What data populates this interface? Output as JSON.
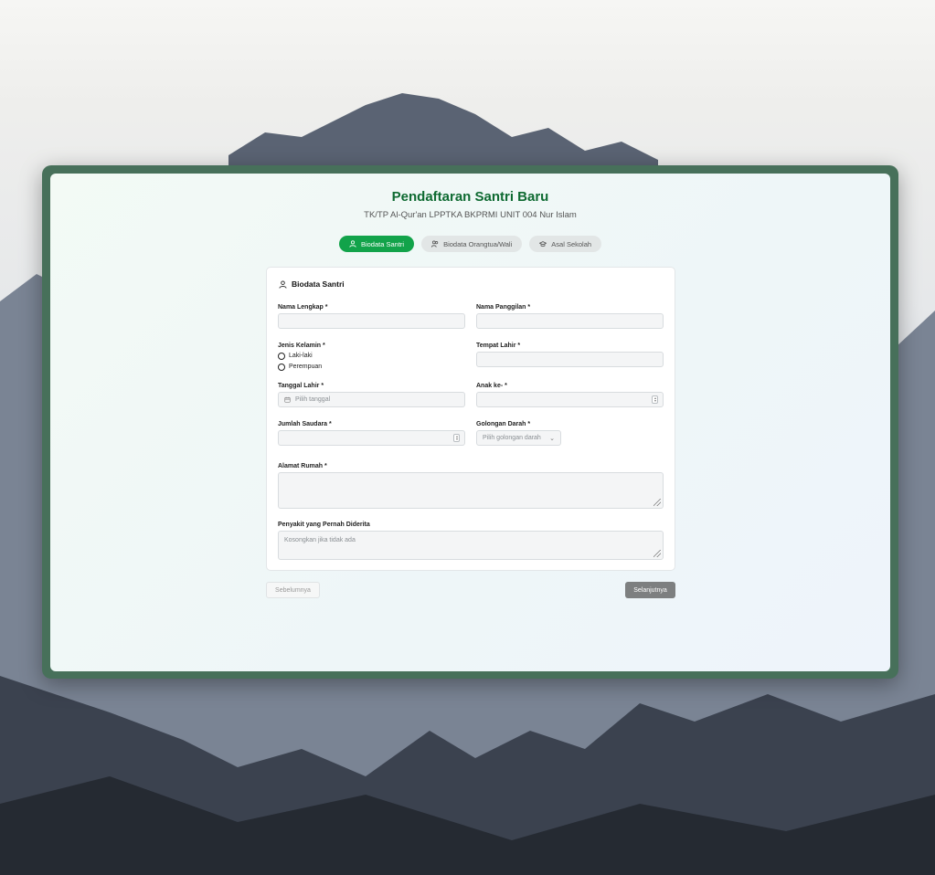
{
  "form": {
    "title": "Pendaftaran Santri Baru",
    "subtitle": "TK/TP Al-Qur'an LPPTKA BKPRMI UNIT 004 Nur Islam"
  },
  "steps": [
    {
      "label": "Biodata Santri",
      "icon": "user-icon",
      "active": true
    },
    {
      "label": "Biodata Orangtua/Wali",
      "icon": "users-icon",
      "active": false
    },
    {
      "label": "Asal Sekolah",
      "icon": "graduation-cap-icon",
      "active": false
    }
  ],
  "section": {
    "title": "Biodata Santri",
    "icon": "user-icon"
  },
  "fields": {
    "nama_lengkap": {
      "label": "Nama Lengkap *",
      "value": ""
    },
    "nama_panggilan": {
      "label": "Nama Panggilan *",
      "value": ""
    },
    "jenis_kelamin": {
      "label": "Jenis Kelamin *",
      "options": [
        "Laki-laki",
        "Perempuan"
      ],
      "selected": null
    },
    "tempat_lahir": {
      "label": "Tempat Lahir *",
      "value": ""
    },
    "tanggal_lahir": {
      "label": "Tanggal Lahir *",
      "placeholder": "Pilih tanggal"
    },
    "anak_ke": {
      "label": "Anak ke- *",
      "value": ""
    },
    "jumlah_saudara": {
      "label": "Jumlah Saudara *",
      "value": ""
    },
    "golongan_darah": {
      "label": "Golongan Darah *",
      "placeholder": "Pilih golongan darah"
    },
    "alamat_rumah": {
      "label": "Alamat Rumah *",
      "value": ""
    },
    "penyakit": {
      "label": "Penyakit yang Pernah Diderita",
      "placeholder": "Kosongkan jika tidak ada"
    }
  },
  "nav": {
    "prev": "Sebelumnya",
    "next": "Selanjutnya"
  },
  "colors": {
    "accent": "#12a34a",
    "title": "#0e6a31",
    "frame": "#47705a"
  }
}
